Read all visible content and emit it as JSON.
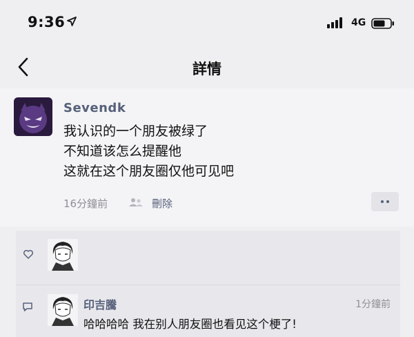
{
  "status_bar": {
    "time": "9:36",
    "network": "4G"
  },
  "nav": {
    "title": "詳情"
  },
  "post": {
    "author": "Sevendk",
    "lines": [
      "我认识的一个朋友被绿了",
      "不知道该怎么提醒他",
      "这就在这个朋友圈仅他可见吧"
    ],
    "time": "16分鐘前",
    "delete_label": "刪除"
  },
  "comment": {
    "name": "印吉騰",
    "time": "1分鐘前",
    "text": "哈哈哈哈 我在别人朋友圈也看见这个梗了!"
  },
  "colors": {
    "link": "#56607a",
    "meta": "#8f8f95",
    "background": "#efeff1"
  }
}
